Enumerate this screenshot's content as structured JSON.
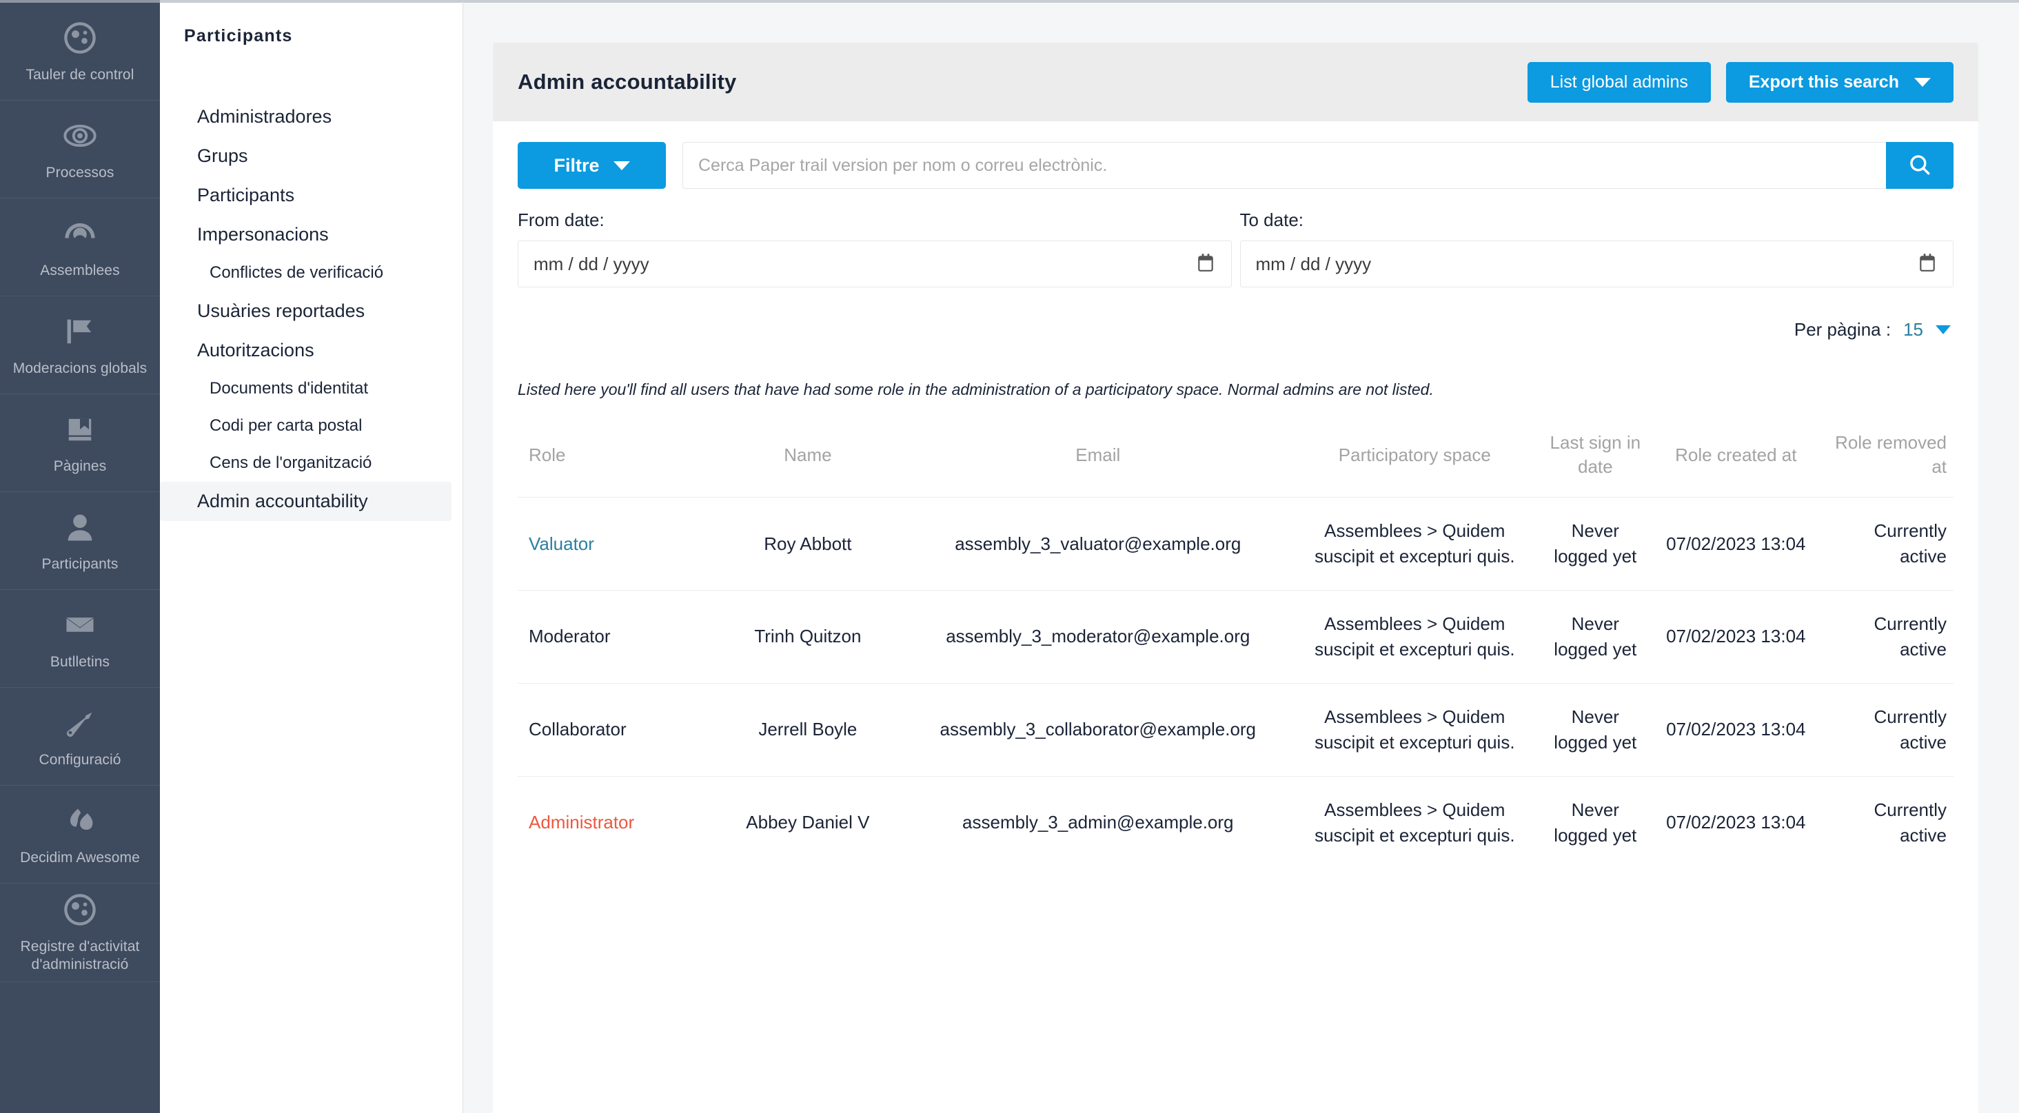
{
  "sidebar": {
    "items": [
      {
        "label": "Tauler de control",
        "icon": "dashboard-icon"
      },
      {
        "label": "Processos",
        "icon": "eye-icon"
      },
      {
        "label": "Assemblees",
        "icon": "assembly-icon"
      },
      {
        "label": "Moderacions globals",
        "icon": "flag-icon"
      },
      {
        "label": "Pàgines",
        "icon": "pages-icon"
      },
      {
        "label": "Participants",
        "icon": "user-icon"
      },
      {
        "label": "Butlletins",
        "icon": "envelope-icon"
      },
      {
        "label": "Configuració",
        "icon": "wrench-icon"
      },
      {
        "label": "Decidim Awesome",
        "icon": "flames-icon"
      },
      {
        "label": "Registre d'activitat d'administració",
        "icon": "dashboard-icon"
      }
    ]
  },
  "secnav": {
    "title": "Participants",
    "items": [
      {
        "label": "Administradores",
        "sub": false,
        "active": false
      },
      {
        "label": "Grups",
        "sub": false,
        "active": false
      },
      {
        "label": "Participants",
        "sub": false,
        "active": false
      },
      {
        "label": "Impersonacions",
        "sub": false,
        "active": false
      },
      {
        "label": "Conflictes de verificació",
        "sub": true,
        "active": false
      },
      {
        "label": "Usuàries reportades",
        "sub": false,
        "active": false
      },
      {
        "label": "Autoritzacions",
        "sub": false,
        "active": false
      },
      {
        "label": "Documents d'identitat",
        "sub": true,
        "active": false
      },
      {
        "label": "Codi per carta postal",
        "sub": true,
        "active": false
      },
      {
        "label": "Cens de l'organització",
        "sub": true,
        "active": false
      },
      {
        "label": "Admin accountability",
        "sub": false,
        "active": true
      }
    ]
  },
  "header": {
    "title": "Admin accountability",
    "list_global_admins_label": "List global admins",
    "export_label": "Export this search"
  },
  "filters": {
    "filtre_label": "Filtre",
    "search_placeholder": "Cerca Paper trail version per nom o correu electrònic.",
    "search_value": "",
    "search_icon": "search-icon",
    "from_date_label": "From date:",
    "from_date_placeholder": "mm / dd / yyyy",
    "from_date_value": "",
    "to_date_label": "To date:",
    "to_date_placeholder": "mm / dd / yyyy",
    "to_date_value": "",
    "per_page_label": "Per pàgina :",
    "per_page_value": "15"
  },
  "note": "Listed here you'll find all users that have had some role in the administration of a participatory space. Normal admins are not listed.",
  "table": {
    "columns": [
      "Role",
      "Name",
      "Email",
      "Participatory space",
      "Last sign in date",
      "Role created at",
      "Role removed at"
    ],
    "rows": [
      {
        "role": "Valuator",
        "role_style": "link",
        "name": "Roy Abbott",
        "email": "assembly_3_valuator@example.org",
        "space": "Assemblees > Quidem suscipit et excepturi quis.",
        "last_sign_in": "Never logged yet",
        "created_at": "07/02/2023 13:04",
        "removed_at": "Currently active"
      },
      {
        "role": "Moderator",
        "role_style": "plain",
        "name": "Trinh Quitzon",
        "email": "assembly_3_moderator@example.org",
        "space": "Assemblees > Quidem suscipit et excepturi quis.",
        "last_sign_in": "Never logged yet",
        "created_at": "07/02/2023 13:04",
        "removed_at": "Currently active"
      },
      {
        "role": "Collaborator",
        "role_style": "plain",
        "name": "Jerrell Boyle",
        "email": "assembly_3_collaborator@example.org",
        "space": "Assemblees > Quidem suscipit et excepturi quis.",
        "last_sign_in": "Never logged yet",
        "created_at": "07/02/2023 13:04",
        "removed_at": "Currently active"
      },
      {
        "role": "Administrator",
        "role_style": "admin",
        "name": "Abbey Daniel V",
        "email": "assembly_3_admin@example.org",
        "space": "Assemblees > Quidem suscipit et excepturi quis.",
        "last_sign_in": "Never logged yet",
        "created_at": "07/02/2023 13:04",
        "removed_at": "Currently active"
      }
    ]
  },
  "colors": {
    "accent_blue": "#0c9ae0",
    "sidebar_bg": "#3e4a5e",
    "role_link": "#2a7fa0",
    "role_admin": "#ec5840",
    "active_green": "#4ec77a",
    "muted": "#9aa3b2"
  }
}
